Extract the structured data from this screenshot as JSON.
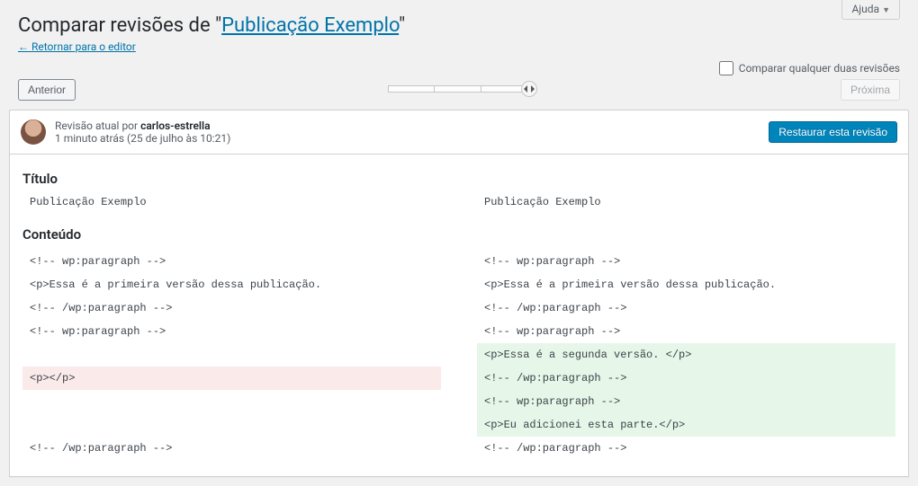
{
  "help_label": "Ajuda",
  "page_title_prefix": "Comparar revisões de \"",
  "page_title_link": "Publicação Exemplo",
  "page_title_suffix": "\"",
  "return_link": "← Retornar para o editor",
  "compare_two_label": "Comparar qualquer duas revisões",
  "prev_label": "Anterior",
  "next_label": "Próxima",
  "meta": {
    "prefix": "Revisão atual por ",
    "author": "carlos-estrella",
    "time_rel": "1 minuto atrás",
    "time_abs": " (25 de julho às 10:21)"
  },
  "restore_label": "Restaurar esta revisão",
  "sections": {
    "title_label": "Título",
    "content_label": "Conteúdo"
  },
  "title_diff": {
    "left": "Publicação Exemplo",
    "right": "Publicação Exemplo"
  },
  "content_diff": [
    {
      "left": "<!-- wp:paragraph -->",
      "right": "<!-- wp:paragraph -->"
    },
    {
      "left": "<p>Essa é a primeira versão dessa publicação.",
      "right": "<p>Essa é a primeira versão dessa publicação."
    },
    {
      "left": "<!-- /wp:paragraph -->",
      "right": "<!-- /wp:paragraph -->"
    },
    {
      "left": "<!-- wp:paragraph -->",
      "right": "<!-- wp:paragraph -->"
    },
    {
      "left": "",
      "left_blank": true,
      "right": "<p>Essa é a segunda versão. </p>",
      "right_class": "added"
    },
    {
      "left": "<p></p>",
      "left_class": "removed",
      "right": "<!-- /wp:paragraph -->",
      "right_class": "added"
    },
    {
      "left": "",
      "left_blank": true,
      "right": "<!-- wp:paragraph -->",
      "right_class": "added"
    },
    {
      "left": "",
      "left_blank": true,
      "right": "<p>Eu adicionei esta parte.</p>",
      "right_class": "added"
    },
    {
      "left": "<!-- /wp:paragraph -->",
      "right": "<!-- /wp:paragraph -->"
    }
  ]
}
